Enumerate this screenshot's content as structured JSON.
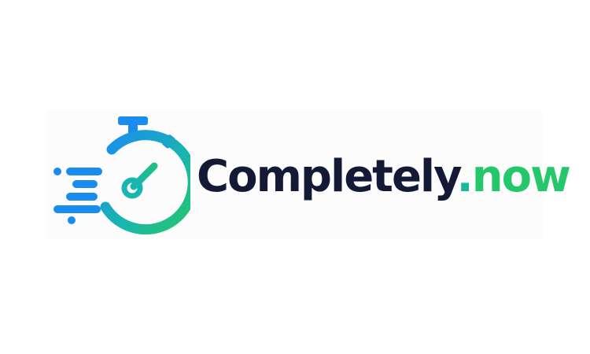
{
  "brand": {
    "name": "Completely",
    "dot": ".",
    "tld": "now"
  },
  "icons": {
    "logo_mark": "stopwatch-speed-icon"
  },
  "colors": {
    "text_dark": "#141a35",
    "blue": "#1a8cf0",
    "teal": "#18b99a",
    "green": "#24c76a"
  }
}
